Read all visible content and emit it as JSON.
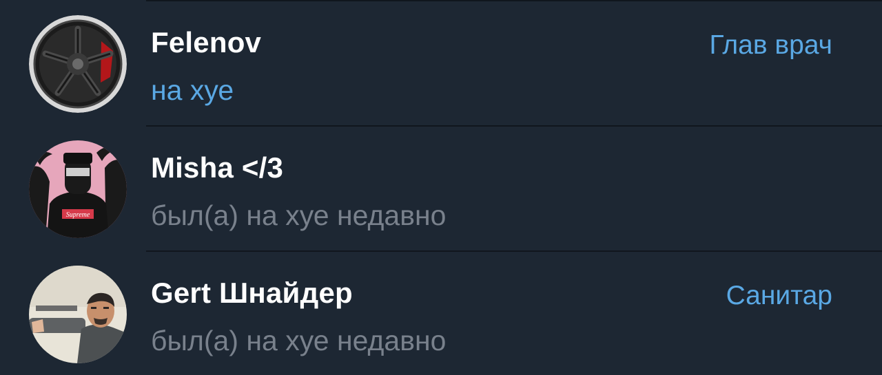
{
  "members": [
    {
      "name": "Felenov",
      "status": "на хуе",
      "status_online": true,
      "role": "Глав врач",
      "avatar": "wheel-rim-avatar"
    },
    {
      "name": "Misha </3",
      "status": "был(а) на хуе недавно",
      "status_online": false,
      "role": "",
      "avatar": "supreme-palms-avatar",
      "avatar_text": "Supreme"
    },
    {
      "name": "Gert Шнайдер",
      "status": "был(а) на хуе недавно",
      "status_online": false,
      "role": "Санитар",
      "avatar": "photo-man-avatar"
    }
  ],
  "colors": {
    "background": "#1d2733",
    "divider": "#10161d",
    "name": "#ffffff",
    "status_offline": "#79818c",
    "accent": "#5aa8e4"
  }
}
